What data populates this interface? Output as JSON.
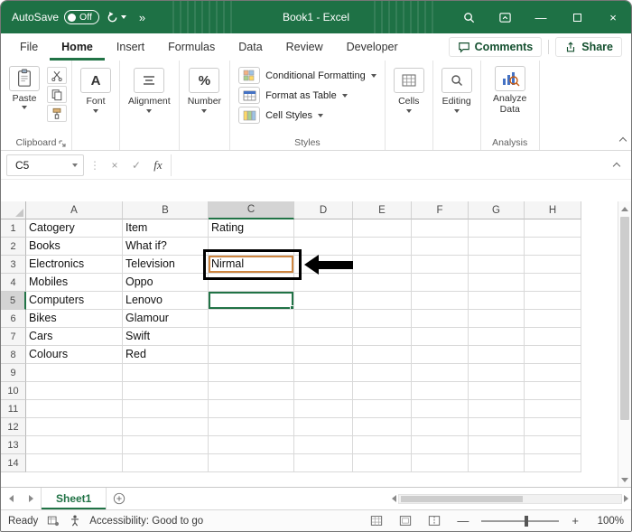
{
  "colors": {
    "titlebar_green": "#1e7145",
    "accent_green": "#217346",
    "annotation_black": "#000000",
    "annotated_cell_border": "#cd8540"
  },
  "glyphs": {
    "more_commands": "»",
    "minimize": "—",
    "close": "×",
    "cancel": "×",
    "check": "✓",
    "dots": "⋮",
    "font_a": "A",
    "percent": "%"
  },
  "title_bar": {
    "autosave_label": "AutoSave",
    "autosave_state": "Off",
    "title": "Book1 - Excel"
  },
  "ribbon_tabs": {
    "tabs": [
      "File",
      "Home",
      "Insert",
      "Formulas",
      "Data",
      "Review",
      "Developer"
    ],
    "active_tab": "Home",
    "comments_label": "Comments",
    "share_label": "Share"
  },
  "ribbon": {
    "paste_label": "Paste",
    "font_label": "Font",
    "alignment_label": "Alignment",
    "number_label": "Number",
    "styles_items": [
      "Conditional Formatting",
      "Format as Table",
      "Cell Styles"
    ],
    "cells_label": "Cells",
    "editing_label": "Editing",
    "analyze_label": "Analyze Data",
    "group_labels": {
      "clipboard": "Clipboard",
      "styles": "Styles",
      "analysis": "Analysis"
    }
  },
  "formula_bar": {
    "name_box": "C5",
    "fx_label": "fx",
    "formula_value": ""
  },
  "grid": {
    "columns": [
      "A",
      "B",
      "C",
      "D",
      "E",
      "F",
      "G",
      "H"
    ],
    "row_count": 14,
    "cells": {
      "A1": "Catogery",
      "B1": "Item",
      "C1": "Rating",
      "A2": "Books",
      "B2": "What if?",
      "A3": "Electronics",
      "B3": "Television",
      "C3": "Nirmal",
      "A4": "Mobiles",
      "B4": "Oppo",
      "A5": "Computers",
      "B5": "Lenovo",
      "A6": "Bikes",
      "B6": "Glamour",
      "A7": "Cars",
      "B7": "Swift",
      "A8": "Colours",
      "B8": "Red"
    },
    "active_cell": "C5",
    "annotated_cell": "C3"
  },
  "sheet_tabs": {
    "tabs": [
      "Sheet1"
    ],
    "active_tab": "Sheet1"
  },
  "status_bar": {
    "ready_label": "Ready",
    "accessibility_label": "Accessibility: Good to go",
    "zoom_out": "—",
    "zoom_in": "+",
    "zoom_label": "100%"
  }
}
